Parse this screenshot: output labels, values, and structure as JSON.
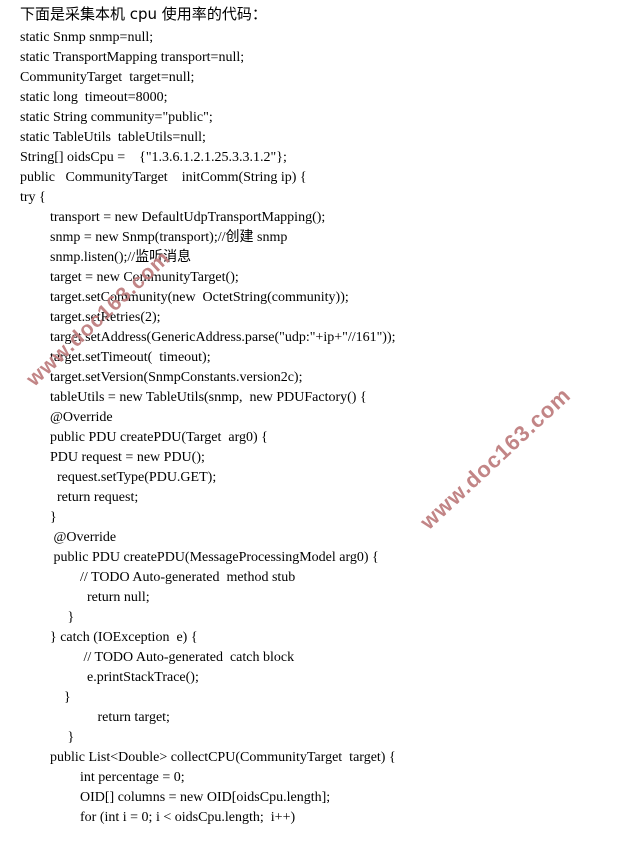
{
  "document": {
    "title": "下面是采集本机 cpu 使用率的代码：",
    "watermarks": [
      {
        "text": "www.doc163.com",
        "color": "#bf7f80"
      },
      {
        "text": "www.doc163.com",
        "color": "#bf7f80"
      }
    ],
    "code_lines": [
      {
        "indent": 0,
        "text": "static Snmp snmp=null;"
      },
      {
        "indent": 0,
        "text": "static TransportMapping transport=null;"
      },
      {
        "indent": 0,
        "text": "CommunityTarget  target=null;"
      },
      {
        "indent": 0,
        "text": "static long  timeout=8000;"
      },
      {
        "indent": 0,
        "text": "static String community=\"public\";"
      },
      {
        "indent": 0,
        "text": "static TableUtils  tableUtils=null;"
      },
      {
        "indent": 0,
        "text": "String[] oidsCpu =    {\"1.3.6.1.2.1.25.3.3.1.2\"};"
      },
      {
        "indent": 0,
        "text": "public   CommunityTarget    initComm(String ip) {"
      },
      {
        "indent": 0,
        "text": "try {"
      },
      {
        "indent": 1,
        "text": "transport = new DefaultUdpTransportMapping();"
      },
      {
        "indent": 1,
        "text": "snmp = new Snmp(transport);//创建 snmp"
      },
      {
        "indent": 1,
        "text": "snmp.listen();//监听消息"
      },
      {
        "indent": 1,
        "text": "target = new CommunityTarget();"
      },
      {
        "indent": 1,
        "text": "target.setCommunity(new  OctetString(community));"
      },
      {
        "indent": 1,
        "text": "target.setRetries(2);"
      },
      {
        "indent": 1,
        "text": "target.setAddress(GenericAddress.parse(\"udp:\"+ip+\"//161\"));"
      },
      {
        "indent": 1,
        "text": "target.setTimeout(  timeout);"
      },
      {
        "indent": 1,
        "text": "target.setVersion(SnmpConstants.version2c);"
      },
      {
        "indent": 1,
        "text": "tableUtils = new TableUtils(snmp,  new PDUFactory() {"
      },
      {
        "indent": 1,
        "text": "@Override"
      },
      {
        "indent": 1,
        "text": "public PDU createPDU(Target  arg0) {"
      },
      {
        "indent": 1,
        "text": "PDU request = new PDU();"
      },
      {
        "indent": 1,
        "text": "  request.setType(PDU.GET);"
      },
      {
        "indent": 1,
        "text": "  return request;"
      },
      {
        "indent": 1,
        "text": "}"
      },
      {
        "indent": 1,
        "text": " @Override"
      },
      {
        "indent": 1,
        "text": " public PDU createPDU(MessageProcessingModel arg0) {"
      },
      {
        "indent": 2,
        "text": "// TODO Auto-generated  method stub"
      },
      {
        "indent": 2,
        "text": "  return null;"
      },
      {
        "indent": 1,
        "text": "     }"
      },
      {
        "indent": 1,
        "text": "} catch (IOException  e) {"
      },
      {
        "indent": 2,
        "text": " // TODO Auto-generated  catch block"
      },
      {
        "indent": 2,
        "text": "  e.printStackTrace();"
      },
      {
        "indent": 1,
        "text": "    }"
      },
      {
        "indent": 2,
        "text": "     return target;"
      },
      {
        "indent": 1,
        "text": "     }"
      },
      {
        "indent": 1,
        "text": "public List<Double> collectCPU(CommunityTarget  target) {"
      },
      {
        "indent": 2,
        "text": "int percentage = 0;"
      },
      {
        "indent": 2,
        "text": "OID[] columns = new OID[oidsCpu.length];"
      },
      {
        "indent": 2,
        "text": "for (int i = 0; i < oidsCpu.length;  i++)"
      }
    ]
  }
}
